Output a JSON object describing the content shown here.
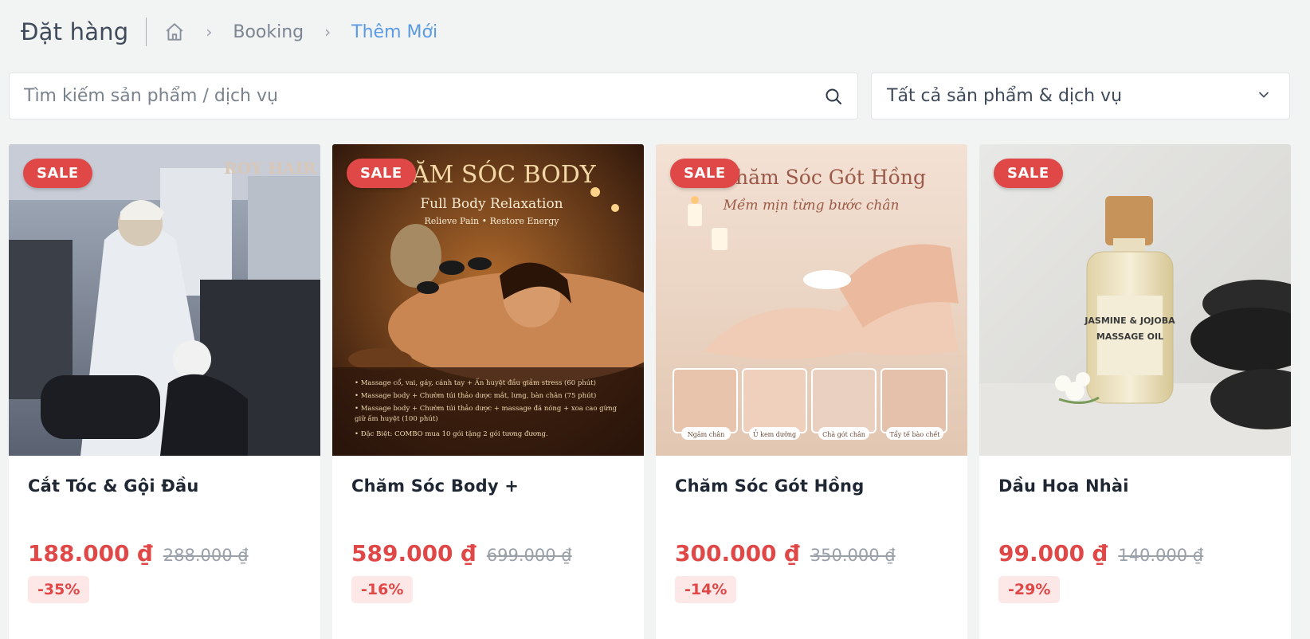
{
  "header": {
    "title": "Đặt hàng",
    "breadcrumb": [
      "Booking",
      "Thêm Mới"
    ]
  },
  "search": {
    "placeholder": "Tìm kiếm sản phẩm / dịch vụ",
    "value": ""
  },
  "filter": {
    "selected": "Tất cả sản phẩm & dịch vụ"
  },
  "colors": {
    "accent": "#e04848",
    "link": "#5b9be6"
  },
  "products": [
    {
      "badge": "SALE",
      "name": "Cắt Tóc & Gội Đầu",
      "price": "188.000 ₫",
      "old_price": "288.000 ₫",
      "discount": "-35%",
      "image_text": {
        "brand": "ROY HAIR"
      }
    },
    {
      "badge": "SALE",
      "name": "Chăm Sóc Body +",
      "price": "589.000 ₫",
      "old_price": "699.000 ₫",
      "discount": "-16%",
      "image_text": {
        "headline": "ĂM SÓC BODY",
        "sub1": "Full Body Relaxation",
        "sub2": "Relieve Pain • Restore Energy",
        "bullets": [
          "• Massage cổ, vai, gáy, cánh tay + Ấn huyệt đầu giảm stress (60 phút)",
          "• Massage body + Chườm túi thảo dược mắt, lưng, bàn chân (75 phút)",
          "• Massage body + Chườm túi thảo dược + massage đá nóng + xoa cao gừng",
          "  giữ ấm huyệt (100 phút)",
          "• Đặc Biệt: COMBO mua 10 gói tặng 2 gói tương đương."
        ]
      }
    },
    {
      "badge": "SALE",
      "name": "Chăm Sóc Gót Hồng",
      "price": "300.000 ₫",
      "old_price": "350.000 ₫",
      "discount": "-14%",
      "image_text": {
        "headline": "hăm Sóc Gót Hồng",
        "sub": "Mềm mịn từng bước chân",
        "steps": [
          "Ngâm chân",
          "Ủ kem dưỡng",
          "Chà gót chân",
          "Tẩy tế bào chết"
        ]
      }
    },
    {
      "badge": "SALE",
      "name": "Dầu Hoa Nhài",
      "price": "99.000 ₫",
      "old_price": "140.000 ₫",
      "discount": "-29%",
      "image_text": {
        "label1": "JASMINE & JOJOBA",
        "label2": "MASSAGE OIL"
      }
    }
  ]
}
